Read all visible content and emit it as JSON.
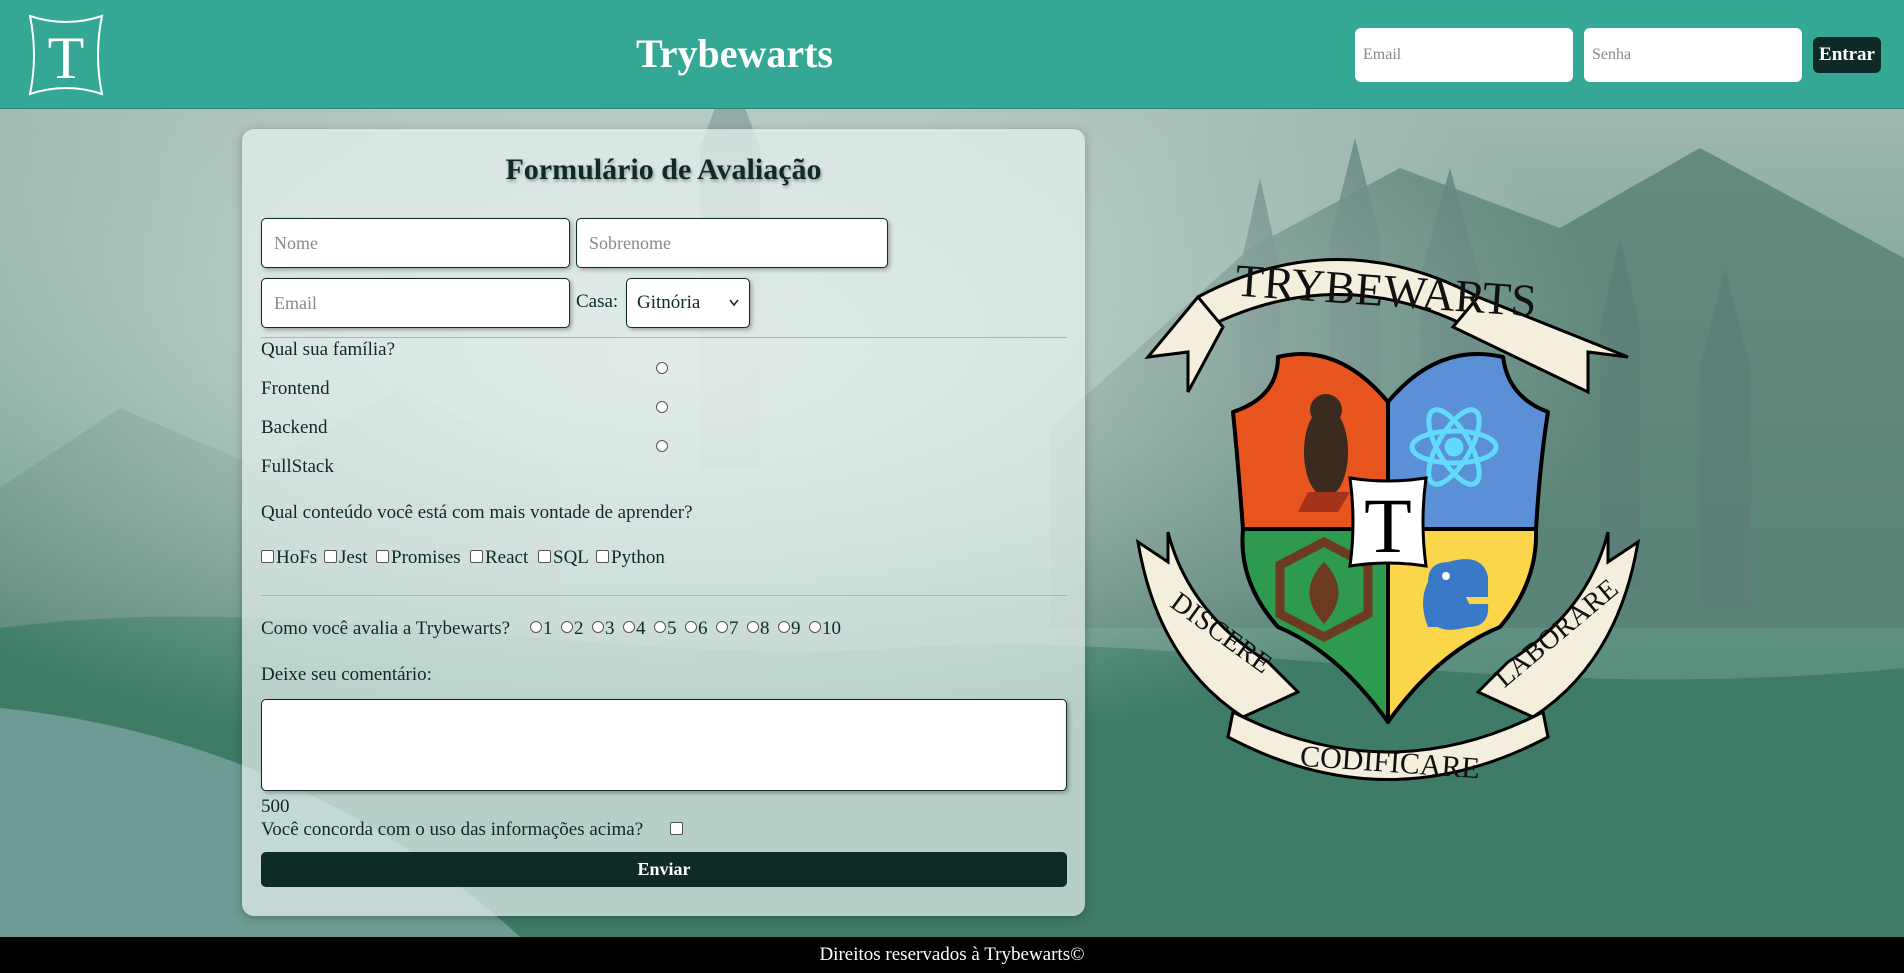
{
  "header": {
    "logo_letter": "T",
    "title": "Trybewarts",
    "login": {
      "email_placeholder": "Email",
      "password_placeholder": "Senha",
      "button_label": "Entrar"
    }
  },
  "form": {
    "title": "Formulário de Avaliação",
    "name_placeholder": "Nome",
    "lastname_placeholder": "Sobrenome",
    "email_placeholder": "Email",
    "house_label": "Casa:",
    "house_selected": "Gitnória",
    "family_question": "Qual sua família?",
    "families": [
      "Frontend",
      "Backend",
      "FullStack"
    ],
    "content_question": "Qual conteúdo você está com mais vontade de aprender?",
    "contents": [
      "HoFs",
      "Jest",
      "Promises",
      "React",
      "SQL",
      "Python"
    ],
    "rating_question": "Como você avalia a Trybewarts?",
    "ratings": [
      "1",
      "2",
      "3",
      "4",
      "5",
      "6",
      "7",
      "8",
      "9",
      "10"
    ],
    "comment_label": "Deixe seu comentário:",
    "char_counter": "500",
    "agreement_label": "Você concorda com o uso das informações acima?",
    "submit_label": "Enviar"
  },
  "crest": {
    "banner_top": "TRYBEWARTS",
    "center_letter": "T",
    "motto_left": "DISCERE",
    "motto_center": "CODIFICARE",
    "motto_right": "LABORARE",
    "colors": {
      "top_left": "#e9551e",
      "top_right": "#5b8fd6",
      "bottom_left": "#2e9a4f",
      "bottom_right": "#fbd54a",
      "ribbon": "#f3efdc"
    }
  },
  "footer": {
    "text": "Direitos reservados à Trybewarts©"
  },
  "theme": {
    "header_bg": "#34a894",
    "dark": "#0e2b26"
  }
}
